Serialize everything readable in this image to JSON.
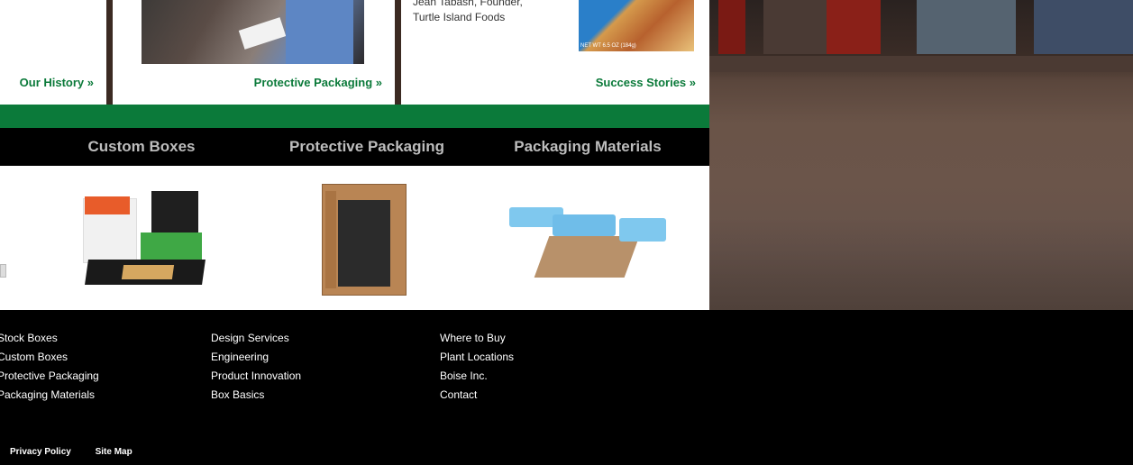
{
  "top_cards": {
    "history_link": "Our History »",
    "protective_link": "Protective Packaging »",
    "stories_link": "Success Stories »",
    "quote_line1": "Jean Tabash, Founder,",
    "quote_line2": "Turtle Island Foods",
    "product_label": "NET WT 6.5 OZ (184g)"
  },
  "nav": {
    "items": [
      "Custom Boxes",
      "Protective Packaging",
      "Packaging Materials"
    ]
  },
  "footer": {
    "col1": [
      "Stock Boxes",
      "Custom Boxes",
      "Protective Packaging",
      "Packaging Materials"
    ],
    "col2": [
      "Design Services",
      "Engineering",
      "Product Innovation",
      "Box Basics"
    ],
    "col3": [
      "Where to Buy",
      "Plant Locations",
      "Boise Inc.",
      "Contact"
    ],
    "legal": [
      "Privacy Policy",
      "Site Map"
    ]
  }
}
